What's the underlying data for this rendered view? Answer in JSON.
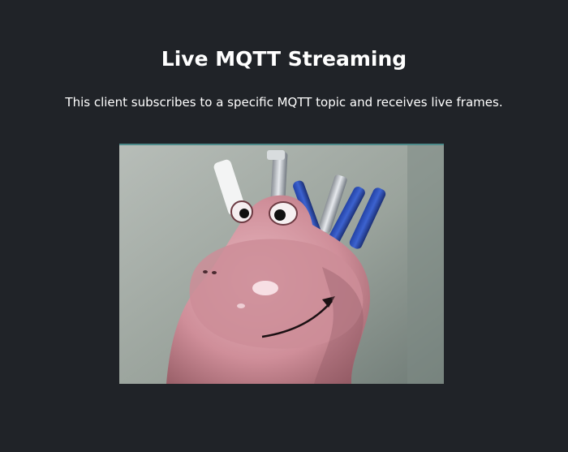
{
  "page": {
    "title": "Live MQTT Streaming",
    "description": "This client subscribes to a specific MQTT topic and receives live frames."
  },
  "stream": {
    "frame_subject": "pink-frog-pen-holder",
    "icon": "video-frame-icon"
  },
  "colors": {
    "background": "#202328",
    "text": "#ffffff",
    "frame_border": "#4d8a8a"
  }
}
